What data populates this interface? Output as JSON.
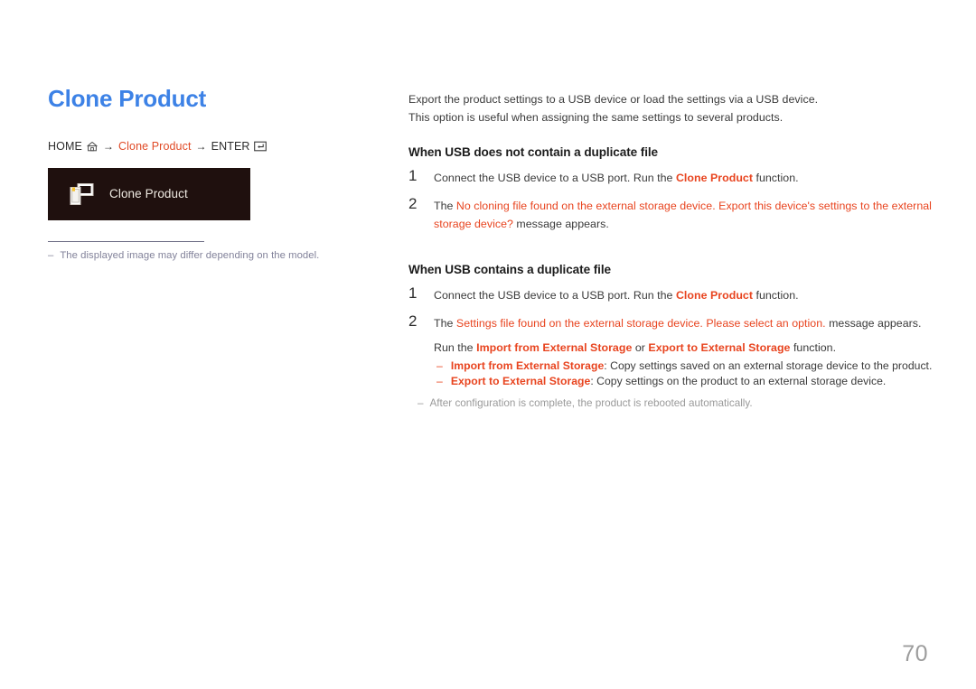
{
  "page": {
    "title": "Clone Product",
    "number": "70"
  },
  "breadcrumb": {
    "home_label": "HOME",
    "home_icon": "home-icon",
    "arrow": "→",
    "menu_label": "Clone Product",
    "enter_label": "ENTER",
    "enter_icon": "enter-key-icon"
  },
  "menu_tile": {
    "icon": "clone-product-icon",
    "label": "Clone Product"
  },
  "left_note": {
    "dash": "–",
    "text": "The displayed image may differ depending on the model."
  },
  "intro": {
    "line1": "Export the product settings to a USB device or load the settings via a USB device.",
    "line2": "This option is useful when assigning the same settings to several products."
  },
  "section1": {
    "heading": "When USB does not contain a duplicate file",
    "steps": [
      {
        "num": "1",
        "pre": "Connect the USB device to a USB port. Run the ",
        "link": "Clone Product",
        "post": " function."
      },
      {
        "num": "2",
        "pre": "The ",
        "link": "No cloning file found on the external storage device. Export this device's settings to the external storage device?",
        "post": " message appears."
      }
    ]
  },
  "section2": {
    "heading": "When USB contains a duplicate file",
    "steps": [
      {
        "num": "1",
        "pre": "Connect the USB device to a USB port. Run the ",
        "link": "Clone Product",
        "post": " function."
      },
      {
        "num": "2",
        "pre": "The ",
        "link": "Settings file found on the external storage device. Please select an option.",
        "post": " message appears."
      }
    ],
    "run_line": {
      "pre": "Run the ",
      "link1": "Import from External Storage",
      "mid": " or ",
      "link2": "Export to External Storage",
      "post": " function."
    },
    "sub_items": [
      {
        "dash": "–",
        "term": "Import from External Storage",
        "desc": ": Copy settings saved on an external storage device to the product."
      },
      {
        "dash": "–",
        "term": "Export to External Storage",
        "desc": ": Copy settings on the product to an external storage device."
      }
    ],
    "tail_note": {
      "dash": "–",
      "text": "After configuration is complete, the product is rebooted automatically."
    }
  },
  "colors": {
    "title_blue": "#3d82e6",
    "accent_orange": "#e8441f",
    "breadcrumb_orange": "#e04a26",
    "tile_bg": "#1f100e",
    "tile_text": "#efeae2",
    "note_gray": "#82829a",
    "page_number_gray": "#9c9c9c"
  }
}
